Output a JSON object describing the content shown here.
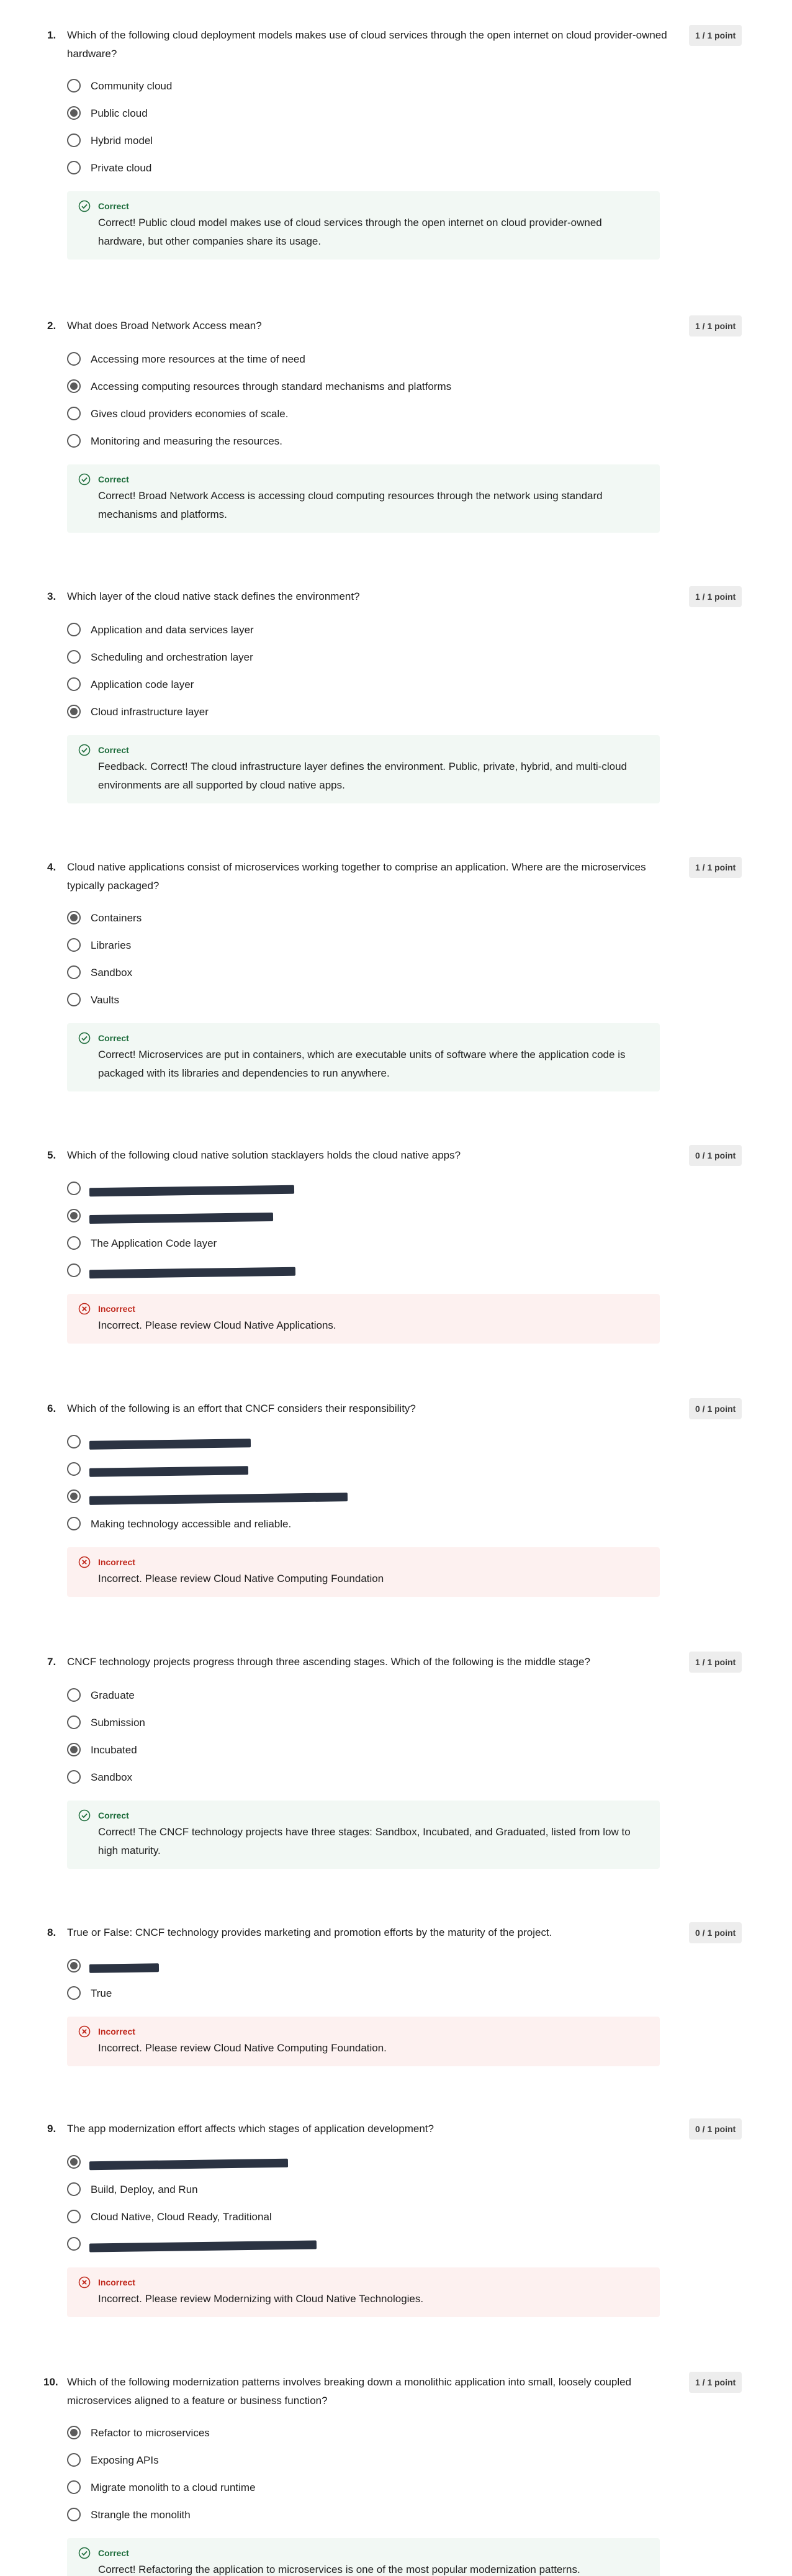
{
  "questions": [
    {
      "number": "1.",
      "text": "Which of the following cloud deployment models makes use of cloud services through the open internet on cloud provider-owned hardware?",
      "score": "1 / 1 point",
      "options": [
        "Community cloud",
        "Public cloud",
        "Hybrid model",
        "Private cloud"
      ],
      "selected": 1,
      "feedback": {
        "status": "Correct",
        "message": "Correct! Public cloud model makes use of cloud services through the open internet on cloud provider-owned hardware, but other companies share its usage."
      }
    },
    {
      "number": "2.",
      "text": "What does Broad Network Access mean?",
      "score": "1 / 1 point",
      "options": [
        "Accessing more resources at the time of need",
        "Accessing computing resources through standard mechanisms and platforms",
        " Gives cloud providers economies of scale.",
        "Monitoring and measuring the resources."
      ],
      "selected": 1,
      "feedback": {
        "status": "Correct",
        "message": " Correct! Broad Network Access is accessing cloud computing resources through the network using standard mechanisms and platforms."
      }
    },
    {
      "number": "3.",
      "text": "Which layer of the cloud native stack defines the environment?",
      "score": "1 / 1 point",
      "options": [
        "Application and data services layer",
        "Scheduling and orchestration layer",
        "Application code layer",
        "Cloud infrastructure layer"
      ],
      "selected": 3,
      "feedback": {
        "status": "Correct",
        "message": "Feedback. Correct! The cloud infrastructure layer defines the environment. Public, private, hybrid, and multi-cloud environments are all supported by cloud native apps."
      }
    },
    {
      "number": "4.",
      "text": "Cloud native applications consist of microservices working together to comprise an application. Where are the microservices typically packaged?",
      "score": "1 / 1 point",
      "options": [
        "Containers",
        "Libraries",
        "Sandbox",
        "Vaults"
      ],
      "selected": 0,
      "feedback": {
        "status": "Correct",
        "message": "Correct! Microservices are put in containers, which are executable units of software where the application code is packaged with its libraries and dependencies to run anywhere."
      }
    },
    {
      "number": "5.",
      "text": "Which of the following cloud native solution stacklayers holds the cloud native apps?",
      "score": "0 / 1 point",
      "options": [
        "",
        "",
        "The Application Code layer",
        ""
      ],
      "selected": 1,
      "feedback": {
        "status": "Incorrect",
        "message": "Incorrect. Please review Cloud Native Applications."
      }
    },
    {
      "number": "6.",
      "text": "Which of the following is an effort that CNCF considers their responsibility?",
      "score": "0 / 1 point",
      "options": [
        "",
        "",
        "",
        "Making technology accessible and reliable."
      ],
      "selected": 2,
      "feedback": {
        "status": "Incorrect",
        "message": "Incorrect. Please review Cloud Native Computing Foundation"
      }
    },
    {
      "number": "7.",
      "text": "CNCF technology projects progress through three ascending stages. Which of the following is the middle stage?",
      "score": "1 / 1 point",
      "options": [
        "Graduate",
        "Submission",
        "Incubated",
        "Sandbox"
      ],
      "selected": 2,
      "feedback": {
        "status": "Correct",
        "message": "Correct! The CNCF technology projects have three stages: Sandbox, Incubated, and Graduated, listed from low to high maturity."
      }
    },
    {
      "number": "8.",
      "text": "True or False: CNCF technology provides marketing and promotion efforts by the maturity of the project.",
      "score": "0 / 1 point",
      "options": [
        "",
        "True"
      ],
      "selected": 0,
      "feedback": {
        "status": "Incorrect",
        "message": "Incorrect. Please review Cloud Native Computing Foundation."
      }
    },
    {
      "number": "9.",
      "text": "The app modernization effort affects which stages of application development?",
      "score": "0 / 1 point",
      "options": [
        "",
        "Build, Deploy, and Run",
        "Cloud Native, Cloud Ready, Traditional",
        ""
      ],
      "selected": 0,
      "feedback": {
        "status": "Incorrect",
        "message": "Incorrect. Please review Modernizing with Cloud Native Technologies."
      }
    },
    {
      "number": "10.",
      "text": "Which of the following modernization patterns involves breaking down a monolithic application into small, loosely coupled microservices aligned to a feature or business function?",
      "score": "1 / 1 point",
      "options": [
        "Refactor to microservices",
        "Exposing APIs",
        "Migrate monolith to a cloud runtime",
        "Strangle the monolith"
      ],
      "selected": 0,
      "feedback": {
        "status": "Correct",
        "message": "Correct! Refactoring the application to microservices is one of the most popular modernization patterns."
      }
    }
  ],
  "icons": {
    "correct": "check-circle-icon",
    "incorrect": "x-circle-icon"
  },
  "colors": {
    "correct_text": "#1e6d3c",
    "correct_bg": "#f2f8f4",
    "incorrect_text": "#c0281c",
    "incorrect_bg": "#fdf1f0",
    "score_badge_bg": "#ededed"
  }
}
